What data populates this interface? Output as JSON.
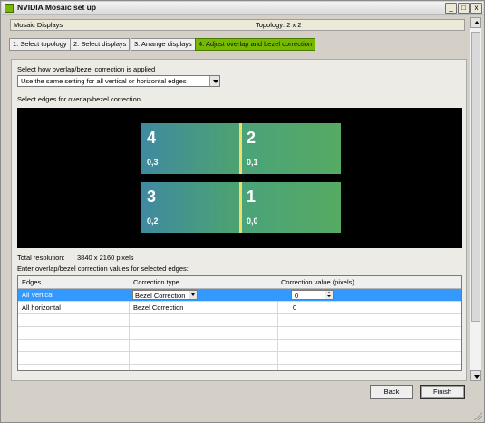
{
  "window": {
    "title": "NVIDIA Mosaic set up",
    "minimize_glyph": "_",
    "maximize_glyph": "□",
    "close_glyph": "x"
  },
  "header": {
    "left": "Mosaic Displays",
    "center": "Topology: 2 x 2"
  },
  "tabs": [
    {
      "label": "1. Select topology"
    },
    {
      "label": "2. Select displays"
    },
    {
      "label": "3. Arrange displays"
    },
    {
      "label": "4. Adjust overlap and bezel correction"
    }
  ],
  "form": {
    "apply_label": "Select how overlap/bezel correction is applied",
    "apply_value": "Use the same setting for all vertical or horizontal edges",
    "edges_label": "Select edges for overlap/bezel correction",
    "total_resolution_label": "Total resolution:",
    "total_resolution_value": "3840 x 2160 pixels",
    "correction_values_label": "Enter overlap/bezel correction values for selected edges:"
  },
  "displays": [
    {
      "number": "4",
      "coords": "0,3"
    },
    {
      "number": "2",
      "coords": "0,1"
    },
    {
      "number": "3",
      "coords": "0,2"
    },
    {
      "number": "1",
      "coords": "0,0"
    }
  ],
  "table": {
    "headers": {
      "edges": "Edges",
      "correction_type": "Correction type",
      "correction_value": "Correction value (pixels)"
    },
    "rows": [
      {
        "edges": "All Vertical",
        "correction_type": "Bezel Correction",
        "correction_value": "0"
      },
      {
        "edges": "All horizontal",
        "correction_type": "Bezel Correction",
        "correction_value": "0"
      }
    ]
  },
  "buttons": {
    "back": "Back",
    "finish": "Finish"
  },
  "colors": {
    "accent": "#76b900",
    "selection": "#3399ff"
  }
}
